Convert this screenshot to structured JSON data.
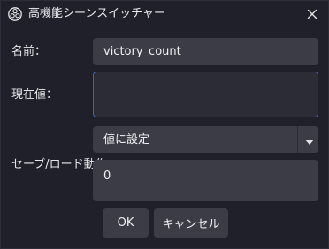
{
  "window": {
    "title": "高機能シーンスイッチャー",
    "app_icon": "obs-logo-icon",
    "close_icon": "close-icon"
  },
  "form": {
    "name_label": "名前：",
    "name_value": "victory_count",
    "current_value_label": "現在値：",
    "current_value_value": "",
    "action_label": "セーブ/ロード動作",
    "action_select_value": "値に設定",
    "action_select_icon": "chevron-down-icon",
    "action_number_value": "0"
  },
  "buttons": {
    "ok_label": "OK",
    "cancel_label": "キャンセル"
  },
  "colors": {
    "background": "#1f2029",
    "field_bg": "#3b3c45",
    "focus_border": "#3f5fc9",
    "text": "#e6e6ea"
  }
}
